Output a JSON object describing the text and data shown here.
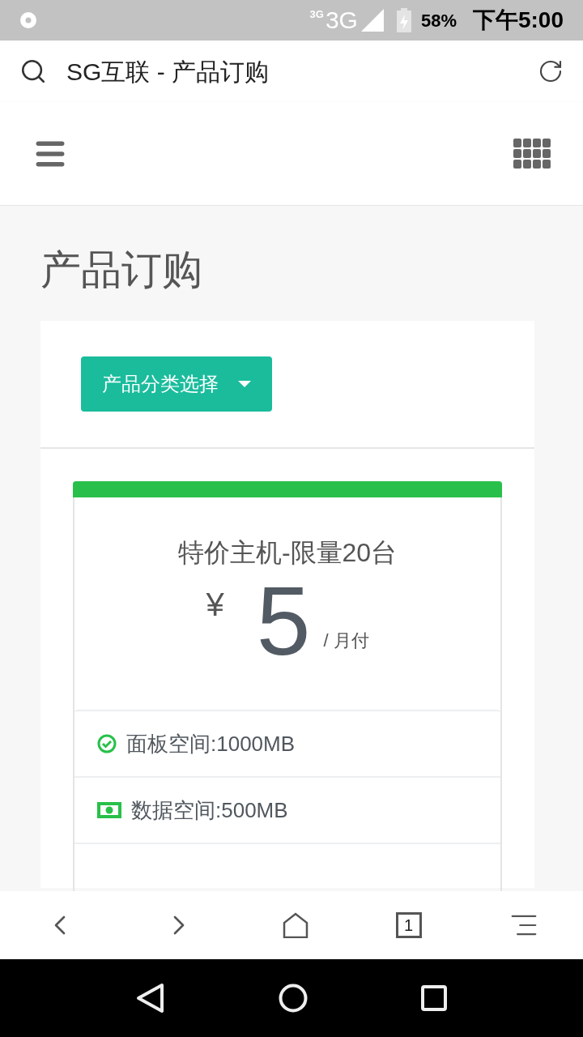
{
  "status_bar": {
    "network_small": "3G",
    "network": "3G",
    "battery": "58%",
    "time": "下午5:00"
  },
  "browser": {
    "title": "SG互联 - 产品订购",
    "tab_count": "1"
  },
  "page": {
    "heading": "产品订购",
    "category_button": "产品分类选择",
    "plan": {
      "name": "特价主机-限量20台",
      "currency": "¥",
      "price": "5",
      "period": "/ 月付",
      "features": [
        {
          "kind": "check",
          "text": "面板空间:1000MB"
        },
        {
          "kind": "money",
          "text": "数据空间:500MB"
        }
      ]
    }
  }
}
